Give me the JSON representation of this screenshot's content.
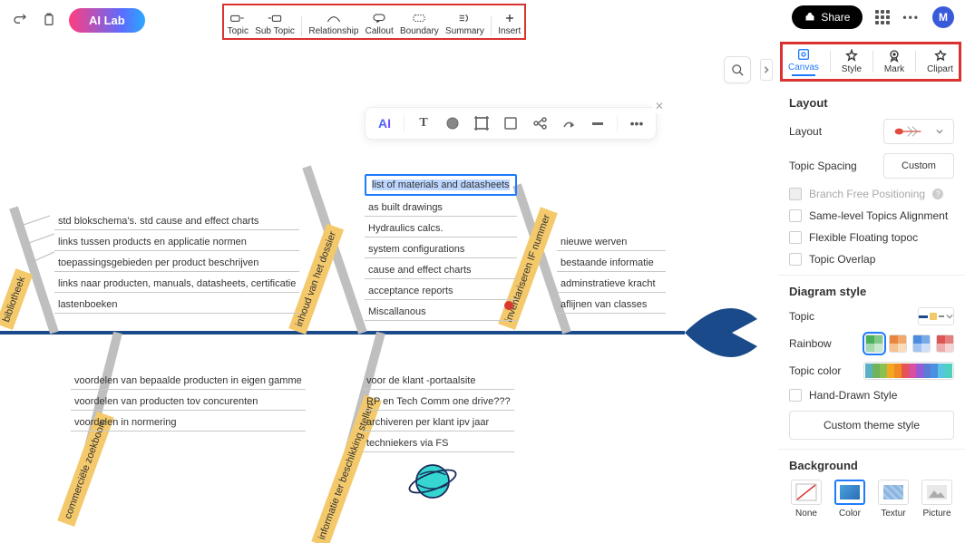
{
  "header": {
    "ai_lab": "AI Lab",
    "share": "Share",
    "avatar": "M"
  },
  "toolbar": [
    {
      "id": "topic",
      "label": "Topic"
    },
    {
      "id": "subtopic",
      "label": "Sub Topic"
    },
    {
      "id": "relationship",
      "label": "Relationship"
    },
    {
      "id": "callout",
      "label": "Callout"
    },
    {
      "id": "boundary",
      "label": "Boundary"
    },
    {
      "id": "summary",
      "label": "Summary"
    },
    {
      "id": "insert",
      "label": "Insert"
    }
  ],
  "tabs": [
    {
      "id": "canvas",
      "label": "Canvas",
      "active": true
    },
    {
      "id": "style",
      "label": "Style"
    },
    {
      "id": "mark",
      "label": "Mark"
    },
    {
      "id": "clipart",
      "label": "Clipart"
    }
  ],
  "panel": {
    "layout_heading": "Layout",
    "layout_label": "Layout",
    "topic_spacing_label": "Topic Spacing",
    "topic_spacing_value": "Custom",
    "branch_free": "Branch Free Positioning",
    "same_level": "Same-level Topics Alignment",
    "flexible": "Flexible Floating topoc",
    "overlap": "Topic Overlap",
    "diagram_style_heading": "Diagram style",
    "topic_label": "Topic",
    "rainbow_label": "Rainbow",
    "topic_color_label": "Topic color",
    "hand_drawn": "Hand-Drawn Style",
    "custom_theme": "Custom theme style",
    "background_heading": "Background",
    "bg_none": "None",
    "bg_color": "Color",
    "bg_textur": "Textur",
    "bg_picture": "Picture",
    "palette": [
      "#5ab0c4",
      "#6fb35b",
      "#8cc051",
      "#f5a623",
      "#f08a24",
      "#e55353",
      "#d94fa0",
      "#9b59d6",
      "#5a7bd6",
      "#4a90e2",
      "#59c3e2",
      "#4dd2c1"
    ]
  },
  "node_toolbar": {
    "ai": "AI"
  },
  "fishbone": {
    "selected_topic": "list of materials and datasheets",
    "bones": [
      {
        "id": "bibliotheek",
        "label": "bibliotheek",
        "side": "top",
        "items": [
          "std blokschema's. std cause and effect charts",
          "links tussen products en applicatie normen",
          "toepassingsgebieden per product beschrijven",
          "links naar producten, manuals, datasheets, certificatie",
          "lastenboeken"
        ]
      },
      {
        "id": "inhoud",
        "label": "inhoud van het dossier",
        "side": "top",
        "items": [
          "list of materials and datasheets",
          "as built drawings",
          "Hydraulics calcs.",
          "system configurations",
          "cause and effect charts",
          "acceptance reports",
          "Miscallanous"
        ]
      },
      {
        "id": "inventariseren",
        "label": "inventariseren IF nummer",
        "side": "top",
        "items": [
          "nieuwe werven",
          "bestaande informatie",
          "adminstratieve kracht",
          "aflijnen van classes"
        ]
      },
      {
        "id": "commerciele",
        "label": "commerciële zoekboom",
        "side": "bottom",
        "items": [
          "voordelen van bepaalde producten in eigen gamme",
          "voordelen van producten tov concurenten",
          "voordelen in normering"
        ]
      },
      {
        "id": "informatie",
        "label": "informatie ter beschikking stellen",
        "side": "bottom",
        "items": [
          "voor de klant -portaalsite",
          "RP en Tech Comm one drive???",
          "archiveren per klant ipv jaar",
          "techniekers via FS"
        ]
      }
    ]
  }
}
